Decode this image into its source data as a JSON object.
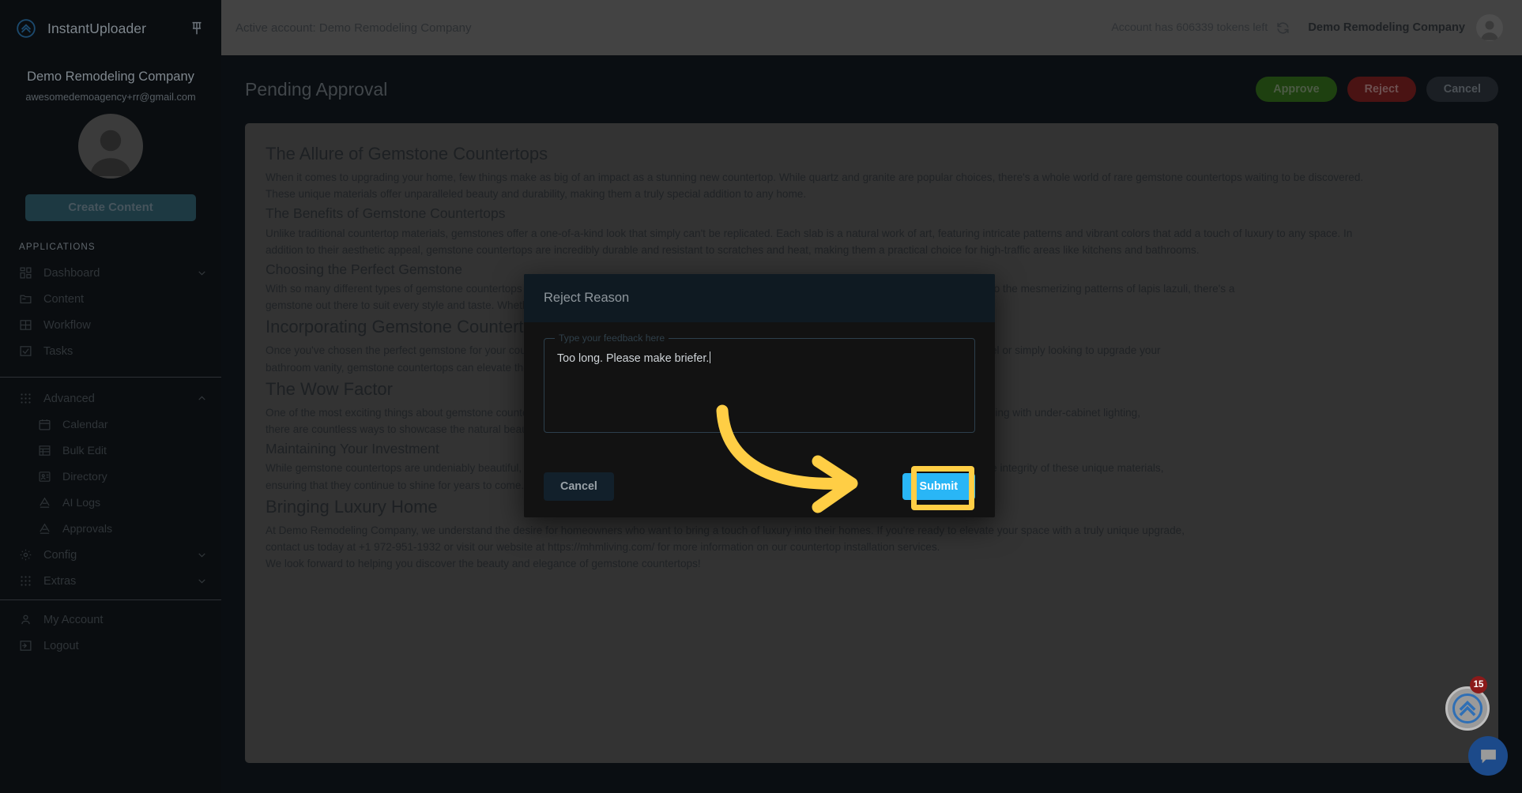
{
  "sidebar": {
    "brand": "InstantUploader",
    "pin_icon": "pin-icon",
    "account_name": "Demo Remodeling Company",
    "account_email": "awesomedemoagency+rr@gmail.com",
    "create_button": "Create Content",
    "section_title": "APPLICATIONS",
    "items": [
      {
        "label": "Dashboard",
        "icon": "dashboard-grid-icon",
        "chevron": "chevron-down-icon"
      },
      {
        "label": "Content",
        "icon": "folder-icon",
        "chevron": ""
      },
      {
        "label": "Workflow",
        "icon": "table-grid-icon",
        "chevron": ""
      },
      {
        "label": "Tasks",
        "icon": "checkbox-check-icon",
        "chevron": ""
      }
    ],
    "advanced": {
      "label": "Advanced",
      "icon": "apps-dots-icon",
      "chevron": "chevron-up-icon"
    },
    "advanced_items": [
      {
        "label": "Calendar",
        "icon": "calendar-icon"
      },
      {
        "label": "Bulk Edit",
        "icon": "list-table-icon"
      },
      {
        "label": "Directory",
        "icon": "contact-card-icon"
      },
      {
        "label": "AI Logs",
        "icon": "ai-triangle-icon"
      },
      {
        "label": "Approvals",
        "icon": "ai-triangle-icon"
      }
    ],
    "config": {
      "label": "Config",
      "icon": "gear-icon",
      "chevron": "chevron-down-icon"
    },
    "extras": {
      "label": "Extras",
      "icon": "apps-dots-icon",
      "chevron": "chevron-down-icon"
    },
    "footer_items": [
      {
        "label": "My Account",
        "icon": "person-icon"
      },
      {
        "label": "Logout",
        "icon": "logout-arrow-icon"
      }
    ]
  },
  "topbar": {
    "active_account": "Active account: Demo Remodeling Company",
    "tokens": "Account has 606339 tokens left",
    "refresh_icon": "refresh-icon",
    "account_name": "Demo Remodeling Company",
    "avatar": "user-avatar"
  },
  "page": {
    "title": "Pending Approval",
    "approve_label": "Approve",
    "reject_label": "Reject",
    "cancel_label": "Cancel"
  },
  "article": {
    "blocks": [
      {
        "type": "h1",
        "text": "The Allure of Gemstone Countertops"
      },
      {
        "type": "p",
        "text": "When it comes to upgrading your home, few things make as big of an impact as a stunning new countertop. While quartz and granite are popular choices, there's a whole world of rare gemstone countertops waiting to be discovered."
      },
      {
        "type": "p",
        "text": "These unique materials offer unparalleled beauty and durability, making them a truly special addition to any home."
      },
      {
        "type": "h2",
        "text": "The Benefits of Gemstone Countertops"
      },
      {
        "type": "p",
        "text": "Unlike traditional countertop materials, gemstones offer a one-of-a-kind look that simply can't be replicated. Each slab is a natural work of art, featuring intricate patterns and vibrant colors that add a touch of luxury to any space. In"
      },
      {
        "type": "p",
        "text": "addition to their aesthetic appeal, gemstone countertops are incredibly durable and resistant to scratches and heat, making them a practical choice for high-traffic areas like kitchens and bathrooms."
      },
      {
        "type": "h2",
        "text": "Choosing the Perfect Gemstone"
      },
      {
        "type": "p",
        "text": "With so many different types of gemstone countertops available, choosing the perfect one can feel overwhelming. From the rich green hues of malachite to the mesmerizing patterns of lapis lazuli, there's a"
      },
      {
        "type": "p",
        "text": "gemstone out there to suit every style and taste. Whether you prefer a bold statement or a subtle accent stone, there's no shortage of options to explore."
      },
      {
        "type": "h1",
        "text": "Incorporating Gemstone Countertops"
      },
      {
        "type": "p",
        "text": "Once you've chosen the perfect gemstone for your countertops, the possibilities are endless for how to use. Whether you're planning a full kitchen remodel or simply looking to upgrade your"
      },
      {
        "type": "p",
        "text": "bathroom vanity, gemstone countertops can elevate the entire look and feel of your space."
      },
      {
        "type": "h1",
        "text": "The Wow Factor"
      },
      {
        "type": "p",
        "text": "One of the most exciting things about gemstone countertops is the sheer wow factor. Design a dramatic waterfall edge or choose to highlight intricate veining with under-cabinet lighting,"
      },
      {
        "type": "p",
        "text": "there are countless ways to showcase the natural beauty of these stones."
      },
      {
        "type": "h2",
        "text": "Maintaining Your Investment"
      },
      {
        "type": "p",
        "text": "While gemstone countertops are undeniably beautiful, they do require some care. Proper sealing and regular maintenance are essential for preserving the integrity of these unique materials,"
      },
      {
        "type": "p",
        "text": "ensuring that they continue to shine for years to come."
      },
      {
        "type": "h1",
        "text": "Bringing Luxury Home"
      },
      {
        "type": "p",
        "text": "At Demo Remodeling Company, we understand the desire for homeowners who want to bring a touch of luxury into their homes. If you're ready to elevate your space with a truly unique upgrade,"
      },
      {
        "type": "p",
        "text": "contact us today at +1 972-951-1932 or visit our website at https://mhmliving.com/ for more information on our countertop installation services."
      },
      {
        "type": "p",
        "text": "We look forward to helping you discover the beauty and elegance of gemstone countertops!"
      }
    ]
  },
  "modal": {
    "title": "Reject Reason",
    "field_label": "Type your feedback here",
    "field_value": "Too long. Please make briefer.",
    "cancel_label": "Cancel",
    "submit_label": "Submit",
    "highlight_color": "#ffce45",
    "submit_color": "#29b6f6"
  },
  "widgets": {
    "chat_icon": "chat-bubble-icon",
    "help_icon": "chevrons-up-icon",
    "badge_count": "15"
  }
}
